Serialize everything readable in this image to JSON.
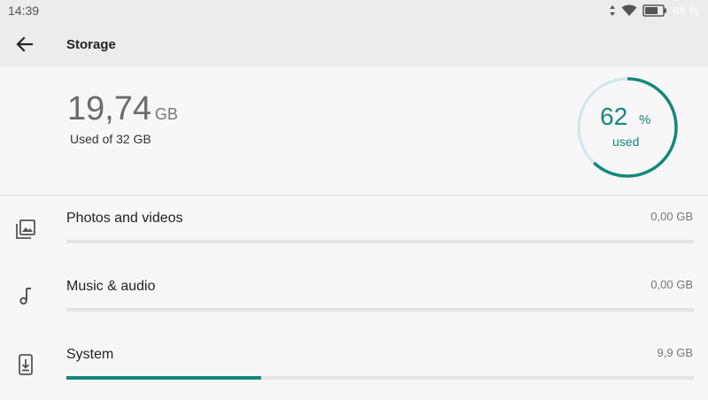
{
  "status_bar": {
    "time": "14:39",
    "battery_percent": "68 %",
    "icons": [
      "data-arrows-icon",
      "wifi-icon",
      "battery-icon"
    ]
  },
  "header": {
    "back_icon": "arrow-left-icon",
    "title": "Storage"
  },
  "summary": {
    "used_value": "19,74",
    "used_unit": "GB",
    "used_caption": "Used of 32 GB",
    "ring_percent": "62",
    "ring_percent_sign": "%",
    "ring_caption": "used",
    "ring_fraction": 0.62
  },
  "categories": [
    {
      "icon": "photo-library-icon",
      "label": "Photos and videos",
      "size": "0,00 GB",
      "fraction": 0.0
    },
    {
      "icon": "music-note-icon",
      "label": "Music & audio",
      "size": "0,00 GB",
      "fraction": 0.0
    },
    {
      "icon": "system-update-icon",
      "label": "System",
      "size": "9,9 GB",
      "fraction": 0.31
    }
  ],
  "colors": {
    "accent": "#14877a",
    "ring_track": "#cfe8e6",
    "bar_track": "#e4e4e4"
  }
}
